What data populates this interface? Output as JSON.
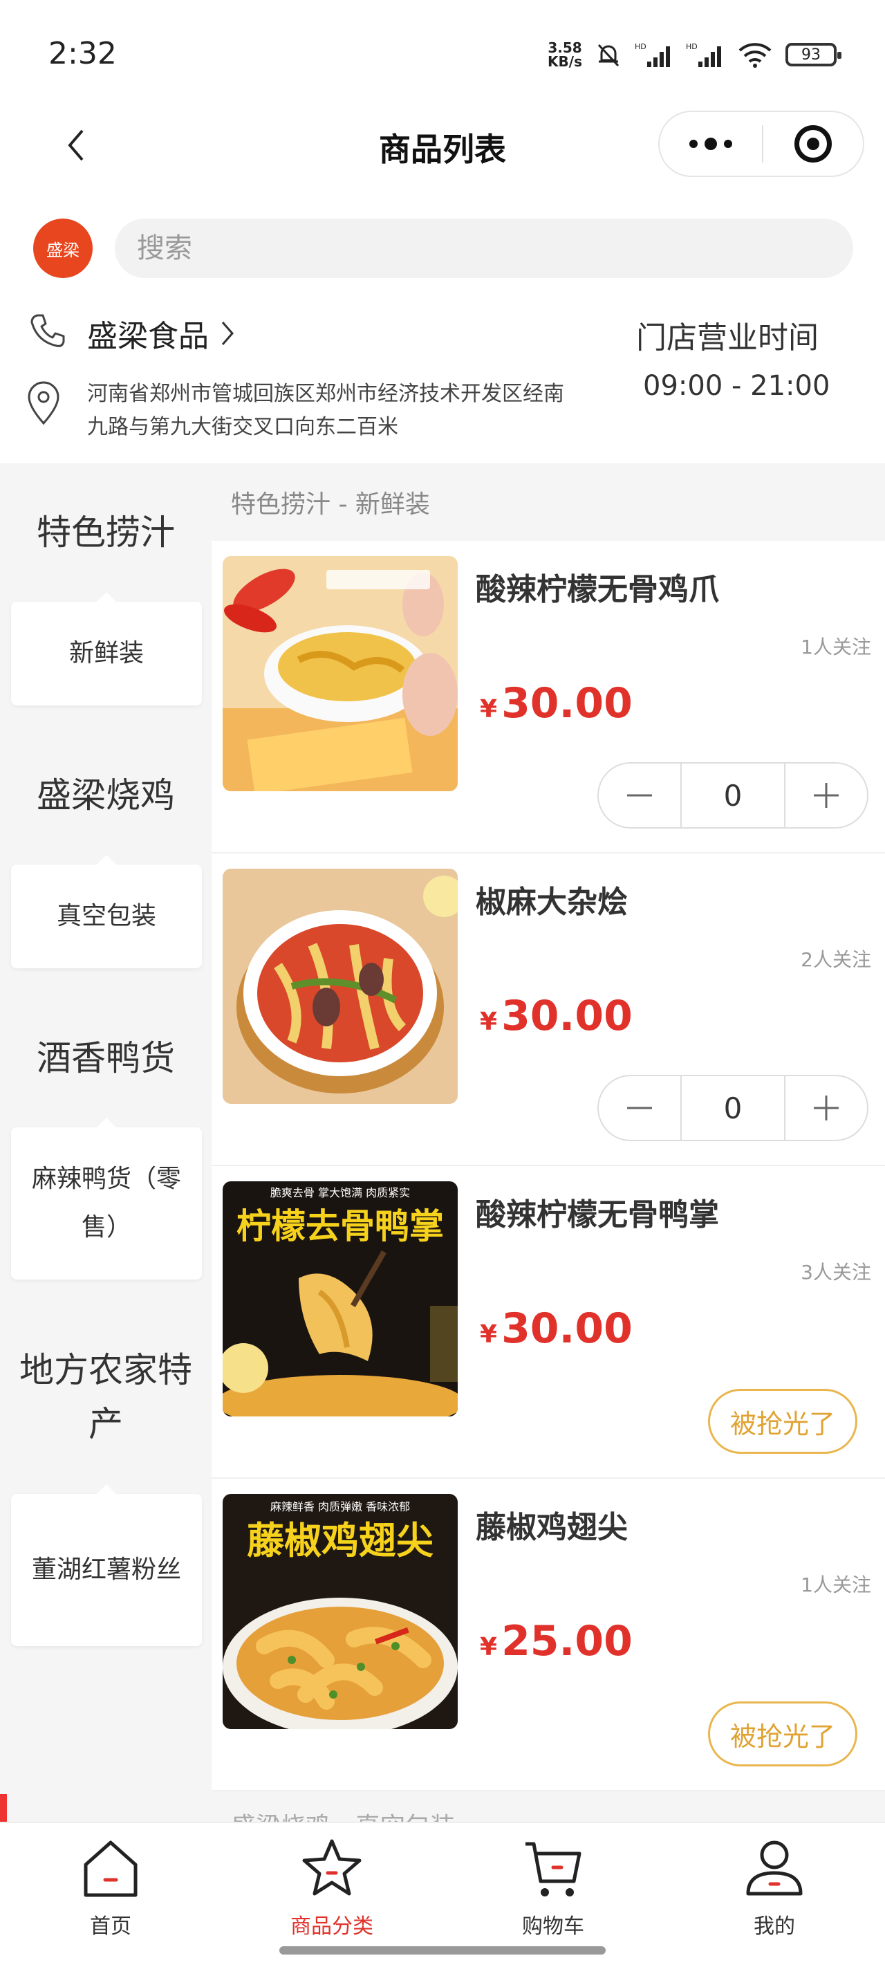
{
  "status_bar": {
    "time": "2:32",
    "net_speed_value": "3.58",
    "net_speed_unit": "KB/s",
    "battery": "93"
  },
  "nav": {
    "title": "商品列表"
  },
  "store": {
    "logo_text": "盛梁",
    "search_placeholder": "搜索",
    "name": "盛梁食品",
    "hours_title": "门店营业时间",
    "hours": "09:00 - 21:00",
    "address": "河南省郑州市管城回族区郑州市经济技术开发区经南九路与第九大街交叉口向东二百米"
  },
  "sidebar": {
    "categories": [
      {
        "label": "特色捞汁",
        "sub": "新鲜装"
      },
      {
        "label": "盛梁烧鸡",
        "sub": "真空包装"
      },
      {
        "label": "酒香鸭货",
        "sub": "麻辣鸭货（零售）"
      },
      {
        "label": "地方农家特产",
        "sub": "董湖红薯粉丝"
      }
    ]
  },
  "list": {
    "section_title": "特色捞汁 - 新鲜装",
    "next_section_title": "盛梁烧鸡 - 真空包装",
    "currency": "¥",
    "soldout_label": "被抢光了",
    "products": [
      {
        "name": "酸辣柠檬无骨鸡爪",
        "followers": "1人关注",
        "price": "30.00",
        "qty": "0"
      },
      {
        "name": "椒麻大杂烩",
        "followers": "2人关注",
        "price": "30.00",
        "qty": "0"
      },
      {
        "name": "酸辣柠檬无骨鸭掌",
        "followers": "3人关注",
        "price": "30.00",
        "banner_top": "脆爽去骨 掌大饱满 肉质紧实",
        "banner_title": "柠檬去骨鸭掌"
      },
      {
        "name": "藤椒鸡翅尖",
        "followers": "1人关注",
        "price": "25.00",
        "banner_top": "麻辣鲜香 肉质弹嫩 香味浓郁",
        "banner_title": "藤椒鸡翅尖"
      }
    ]
  },
  "tabs": [
    {
      "label": "首页",
      "icon": "home-icon"
    },
    {
      "label": "商品分类",
      "icon": "category-star-icon"
    },
    {
      "label": "购物车",
      "icon": "cart-icon"
    },
    {
      "label": "我的",
      "icon": "profile-icon"
    }
  ],
  "colors": {
    "price_red": "#e0322b",
    "brand_orange": "#e8461e",
    "soldout_gold": "#e0a232"
  }
}
